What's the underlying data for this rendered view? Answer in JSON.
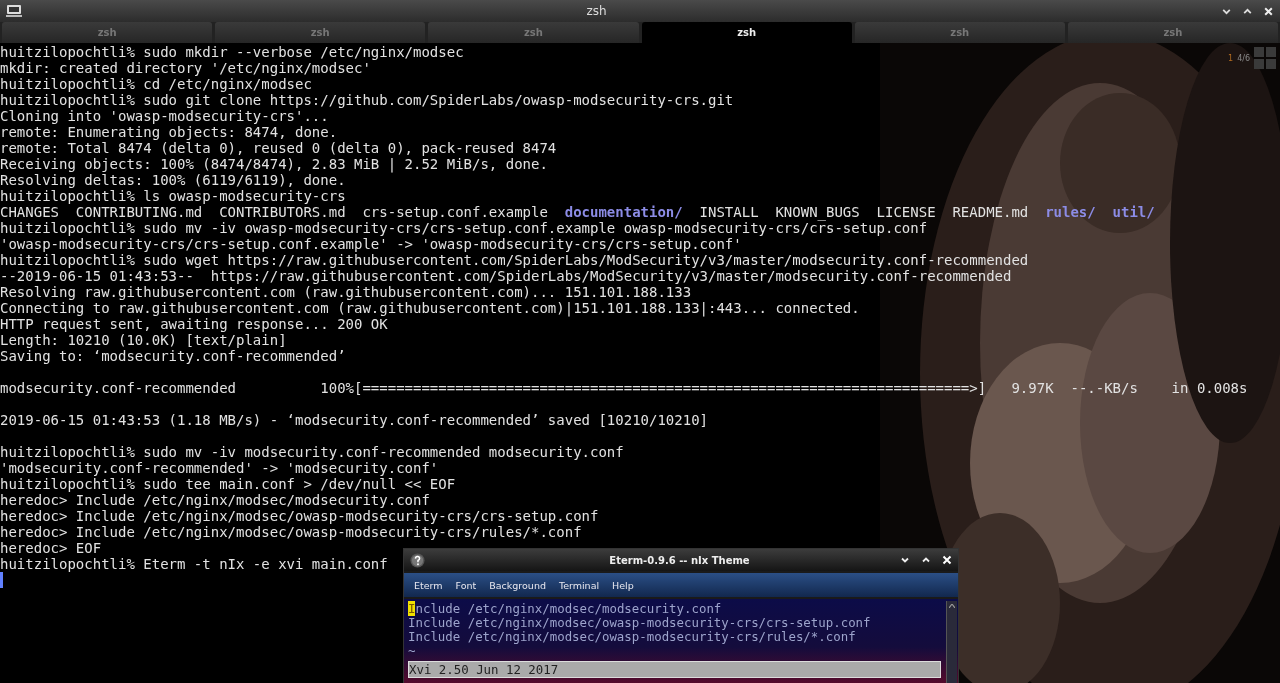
{
  "window": {
    "title": "zsh"
  },
  "tabs": [
    {
      "label": "zsh",
      "selected": false
    },
    {
      "label": "zsh",
      "selected": false
    },
    {
      "label": "zsh",
      "selected": false
    },
    {
      "label": "zsh",
      "selected": true
    },
    {
      "label": "zsh",
      "selected": false
    },
    {
      "label": "zsh",
      "selected": false
    }
  ],
  "pager": {
    "desktop": "1",
    "position": "4/6"
  },
  "terminal": {
    "cursor_visible": true,
    "lines": [
      {
        "text": "huitzilopochtli% sudo mkdir --verbose /etc/nginx/modsec"
      },
      {
        "text": "mkdir: created directory '/etc/nginx/modsec'"
      },
      {
        "text": "huitzilopochtli% cd /etc/nginx/modsec"
      },
      {
        "text": "huitzilopochtli% sudo git clone https://github.com/SpiderLabs/owasp-modsecurity-crs.git"
      },
      {
        "text": "Cloning into 'owasp-modsecurity-crs'..."
      },
      {
        "text": "remote: Enumerating objects: 8474, done."
      },
      {
        "text": "remote: Total 8474 (delta 0), reused 0 (delta 0), pack-reused 8474"
      },
      {
        "text": "Receiving objects: 100% (8474/8474), 2.83 MiB | 2.52 MiB/s, done."
      },
      {
        "text": "Resolving deltas: 100% (6119/6119), done."
      },
      {
        "text": "huitzilopochtli% ls owasp-modsecurity-crs"
      },
      {
        "entries": [
          {
            "text": "CHANGES",
            "kind": "file"
          },
          {
            "text": "CONTRIBUTING.md",
            "kind": "file"
          },
          {
            "text": "CONTRIBUTORS.md",
            "kind": "file"
          },
          {
            "text": "crs-setup.conf.example",
            "kind": "file"
          },
          {
            "text": "documentation/",
            "kind": "dir"
          },
          {
            "text": "INSTALL",
            "kind": "file"
          },
          {
            "text": "KNOWN_BUGS",
            "kind": "file"
          },
          {
            "text": "LICENSE",
            "kind": "file"
          },
          {
            "text": "README.md",
            "kind": "file"
          },
          {
            "text": "rules/",
            "kind": "dir"
          },
          {
            "text": "util/",
            "kind": "dir"
          }
        ]
      },
      {
        "text": "huitzilopochtli% sudo mv -iv owasp-modsecurity-crs/crs-setup.conf.example owasp-modsecurity-crs/crs-setup.conf"
      },
      {
        "text": "'owasp-modsecurity-crs/crs-setup.conf.example' -> 'owasp-modsecurity-crs/crs-setup.conf'"
      },
      {
        "text": "huitzilopochtli% sudo wget https://raw.githubusercontent.com/SpiderLabs/ModSecurity/v3/master/modsecurity.conf-recommended"
      },
      {
        "text": "--2019-06-15 01:43:53--  https://raw.githubusercontent.com/SpiderLabs/ModSecurity/v3/master/modsecurity.conf-recommended"
      },
      {
        "text": "Resolving raw.githubusercontent.com (raw.githubusercontent.com)... 151.101.188.133"
      },
      {
        "text": "Connecting to raw.githubusercontent.com (raw.githubusercontent.com)|151.101.188.133|:443... connected."
      },
      {
        "text": "HTTP request sent, awaiting response... 200 OK"
      },
      {
        "text": "Length: 10210 (10.0K) [text/plain]"
      },
      {
        "text": "Saving to: ‘modsecurity.conf-recommended’"
      },
      {
        "text": "modsecurity.conf-recommended          100%[========================================================================>]   9.97K  --.-KB/s    in 0.008s",
        "blank_before": true
      },
      {
        "text": "2019-06-15 01:43:53 (1.18 MB/s) - ‘modsecurity.conf-recommended’ saved [10210/10210]",
        "blank_before": true
      },
      {
        "text": "huitzilopochtli% sudo mv -iv modsecurity.conf-recommended modsecurity.conf",
        "blank_before": true
      },
      {
        "text": "'modsecurity.conf-recommended' -> 'modsecurity.conf'"
      },
      {
        "text": "huitzilopochtli% sudo tee main.conf > /dev/null << EOF"
      },
      {
        "text": "heredoc> Include /etc/nginx/modsec/modsecurity.conf"
      },
      {
        "text": "heredoc> Include /etc/nginx/modsec/owasp-modsecurity-crs/crs-setup.conf"
      },
      {
        "text": "heredoc> Include /etc/nginx/modsec/owasp-modsecurity-crs/rules/*.conf"
      },
      {
        "text": "heredoc> EOF"
      },
      {
        "text": "huitzilopochtli% Eterm -t nIx -e xvi main.conf"
      }
    ]
  },
  "eterm": {
    "title": "Eterm-0.9.6 -- nIx Theme",
    "menu": [
      "Eterm",
      "Font",
      "Background",
      "Terminal",
      "Help"
    ],
    "lines": [
      {
        "text": "Include /etc/nginx/modsec/modsecurity.conf",
        "cursor": true
      },
      {
        "text": "Include /etc/nginx/modsec/owasp-modsecurity-crs/crs-setup.conf",
        "cursor": false
      },
      {
        "text": "Include /etc/nginx/modsec/owasp-modsecurity-crs/rules/*.conf",
        "cursor": false
      },
      {
        "text": "~",
        "cursor": false
      }
    ],
    "status": "Xvi 2.50 Jun 12 2017"
  }
}
